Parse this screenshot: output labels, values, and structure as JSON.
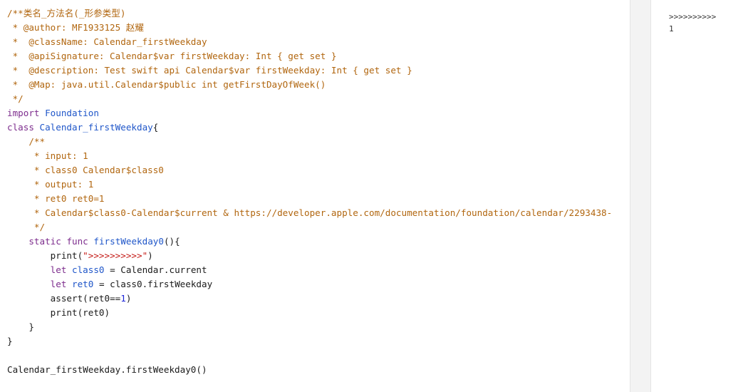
{
  "code": {
    "header": {
      "l1": "/**类名_方法名(_形参类型)",
      "l2": " * @author: MF1933125 赵耀",
      "l3": " *  @className: Calendar_firstWeekday",
      "l4": " *  @apiSignature: Calendar$var firstWeekday: Int { get set }",
      "l5": " *  @description: Test swift api Calendar$var firstWeekday: Int { get set }",
      "l6": " *  @Map: java.util.Calendar$public int getFirstDayOfWeek()",
      "l7": " */"
    },
    "import_kw": "import",
    "import_mod": "Foundation",
    "class_kw": "class",
    "class_name": "Calendar_firstWeekday",
    "class_open": "{",
    "doc": {
      "l1": "    /**",
      "l2": "     * input: 1",
      "l3": "     * class0 Calendar$class0",
      "l4": "     * output: 1",
      "l5": "     * ret0 ret0=1",
      "l6": "     * Calendar$class0-Calendar$current & https://developer.apple.com/documentation/foundation/calendar/2293438-",
      "l7": "     */"
    },
    "func_kw1": "static",
    "func_kw2": "func",
    "func_name": "firstWeekday0",
    "func_sig_rest": "(){",
    "body": {
      "print1_fn": "print(",
      "print1_str": "\">>>>>>>>>>\"",
      "print1_close": ")",
      "let1_kw": "let",
      "let1_var": "class0",
      "let1_rest": " = Calendar.current",
      "let2_kw": "let",
      "let2_var": "ret0",
      "let2_rest": " = class0.firstWeekday",
      "assert_pre": "assert(ret0==",
      "assert_num": "1",
      "assert_post": ")",
      "print2": "print(ret0)"
    },
    "func_close": "}",
    "class_close": "}",
    "call": "Calendar_firstWeekday.firstWeekday0()"
  },
  "output": {
    "lines": [
      ">>>>>>>>>>",
      "1"
    ]
  },
  "colors": {
    "comment": "#b1660f",
    "keyword": "#7d2d8d",
    "type": "#1f56c9",
    "string": "#c41a16",
    "number": "#1c24d8",
    "gutter": "#f3f3f3"
  }
}
